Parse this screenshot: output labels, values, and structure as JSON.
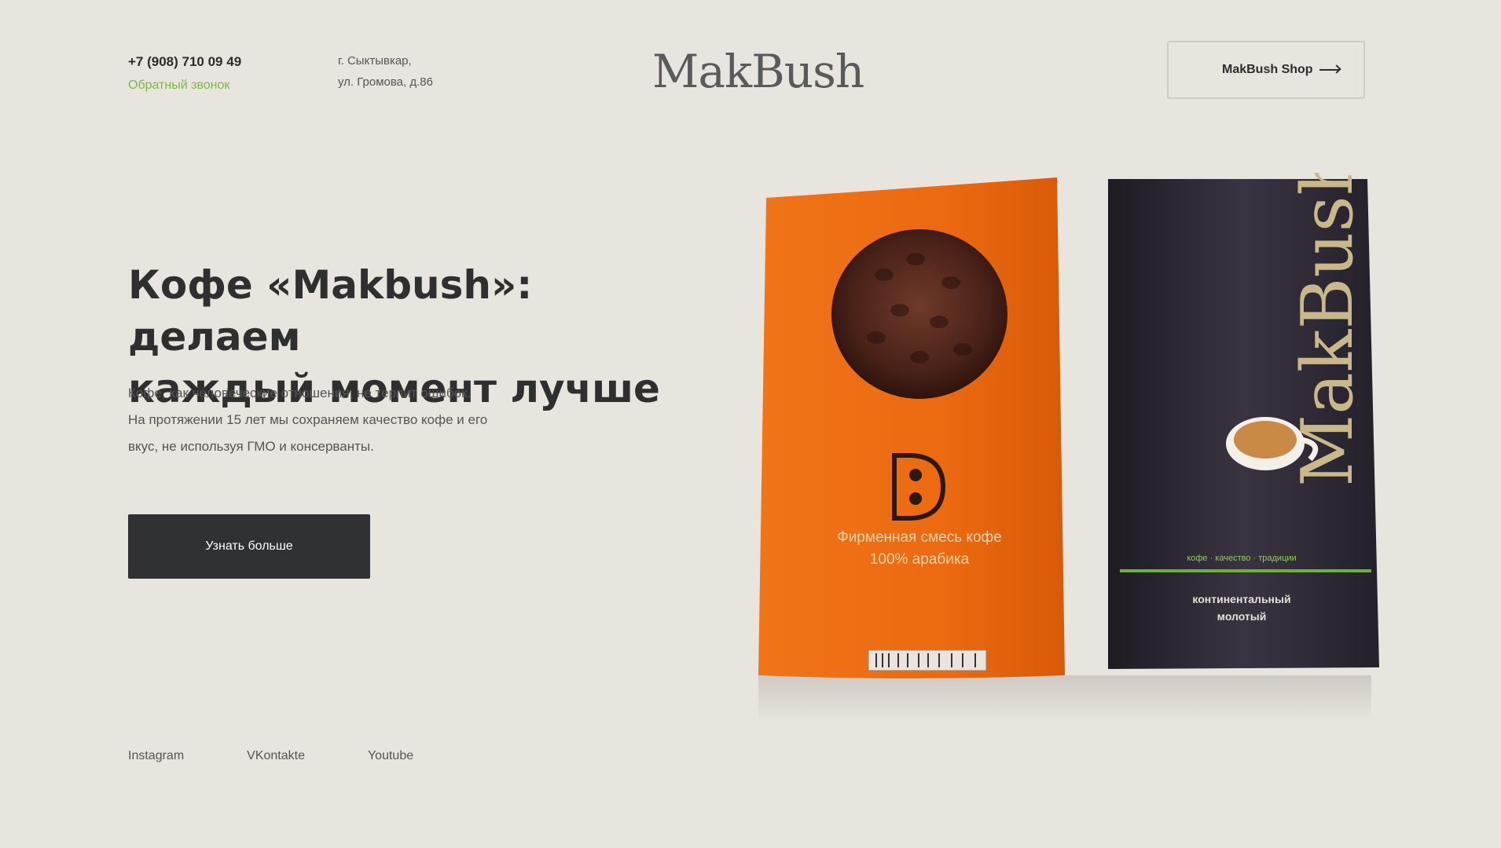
{
  "header": {
    "phone": "+7 (908) 710 09 49",
    "callback_label": "Обратный звонок",
    "address_line1": "г. Сыктывкар,",
    "address_line2": "ул. Громова, д.86",
    "logo": "MakBush",
    "shop_button_label": "MakBush Shop",
    "shop_button_icon": "arrow-right-icon"
  },
  "hero": {
    "title_line1": "Кофе «Makbush»: делаем",
    "title_line2": "каждый момент лучше",
    "description_line1": "Кофе, как человеческие отношения, не терпит ошибок.",
    "description_line2": "На протяжении 15 лет мы сохраняем качество кофе и его",
    "description_line3": "вкус, не используя ГМО и консерванты.",
    "more_button_label": "Узнать больше"
  },
  "products": {
    "orange_pack_line1": "Фирменная смесь кофе",
    "orange_pack_line2": "100% арабика",
    "black_pack_brand": "MakBush",
    "black_pack_tagline": "кофе · качество · традиции",
    "black_pack_line1": "континентальный",
    "black_pack_line2": "молотый"
  },
  "social": {
    "instagram": "Instagram",
    "vkontakte": "VKontakte",
    "youtube": "Youtube"
  },
  "colors": {
    "background": "#e8e4de",
    "accent_green": "#7db64a",
    "button_dark": "#2f3133",
    "pack_orange": "#ee6a12",
    "pack_black": "#2a2630"
  }
}
